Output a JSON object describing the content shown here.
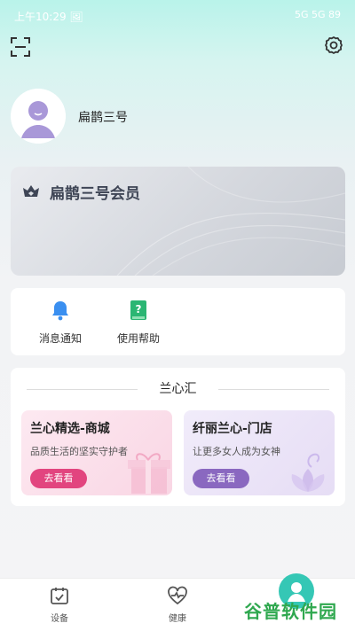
{
  "status_bar": {
    "time": "上午10:29 🖼",
    "indicators": "5G 5G 89"
  },
  "profile": {
    "username": "扁鹊三号"
  },
  "member_card": {
    "title": "扁鹊三号会员"
  },
  "quick_links": [
    {
      "label": "消息通知",
      "icon": "bell-icon"
    },
    {
      "label": "使用帮助",
      "icon": "help-book-icon"
    }
  ],
  "lanxin": {
    "title": "兰心汇",
    "cards": [
      {
        "title": "兰心精选-商城",
        "subtitle": "品质生活的坚实守护者",
        "button": "去看看",
        "button_color": "#e2457f"
      },
      {
        "title": "纤丽兰心-门店",
        "subtitle": "让更多女人成为女神",
        "button": "去看看",
        "button_color": "#8a68c0"
      }
    ]
  },
  "tabbar": [
    {
      "label": "设备",
      "icon": "device-icon"
    },
    {
      "label": "健康",
      "icon": "heart-pulse-icon"
    }
  ],
  "watermark": "谷普软件园",
  "colors": {
    "accent": "#35c7b5",
    "bell": "#3a8ff0",
    "help": "#2bb673"
  }
}
